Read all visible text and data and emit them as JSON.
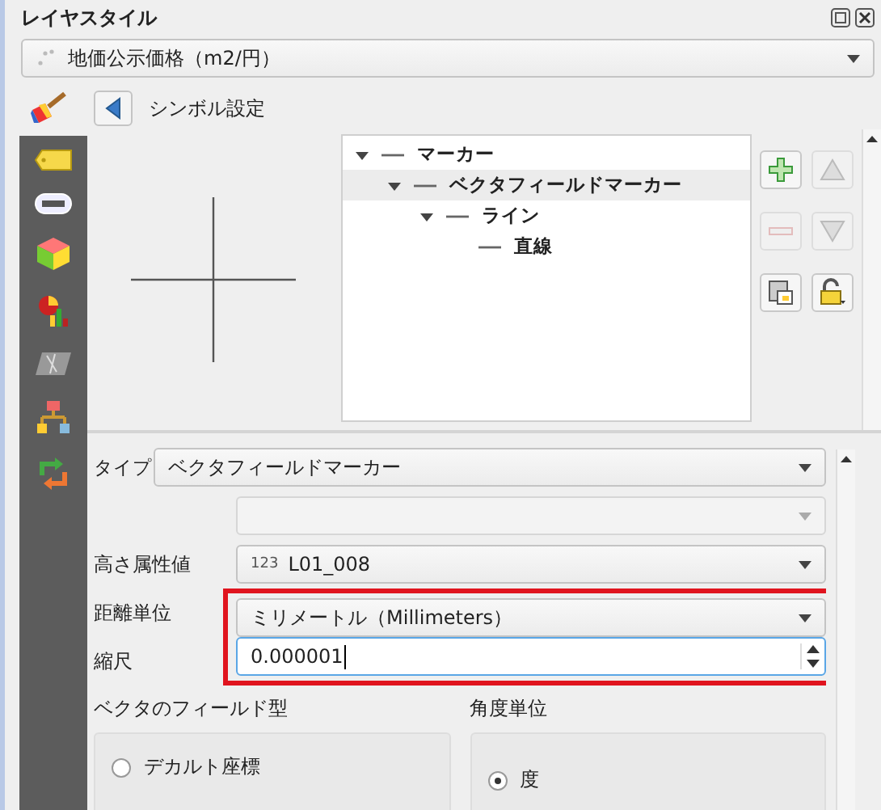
{
  "window": {
    "title": "レイヤスタイル"
  },
  "layer_combo": {
    "value": "地価公示価格（m2/円）"
  },
  "symbol_header": {
    "title": "シンボル設定"
  },
  "symbol_tree": [
    {
      "label": "マーカー",
      "selected": false,
      "expanded": true,
      "children": [
        {
          "label": "ベクタフィールドマーカー",
          "selected": true,
          "expanded": true,
          "children": [
            {
              "label": "ライン",
              "selected": false,
              "expanded": true,
              "children": [
                {
                  "label": "直線",
                  "selected": false
                }
              ]
            }
          ]
        }
      ]
    }
  ],
  "layer_buttons": [
    {
      "kind": "add",
      "disabled": false
    },
    {
      "kind": "up",
      "disabled": true
    },
    {
      "kind": "remove",
      "disabled": true
    },
    {
      "kind": "down",
      "disabled": true
    },
    {
      "kind": "duplicate",
      "disabled": false
    },
    {
      "kind": "lock",
      "disabled": false
    }
  ],
  "type_row": {
    "label": "タイプ",
    "value": "ベクタフィールドマーカー"
  },
  "form_rows": [
    {
      "kind": "combo",
      "disabled": true,
      "highlighted": false
    },
    {
      "kind": "combo",
      "label": "高さ属性値",
      "badge": "123",
      "value": "L01_008",
      "disabled": false,
      "highlighted": false
    },
    {
      "kind": "combo",
      "label": "距離単位",
      "value": "ミリメートル（Millimeters）",
      "disabled": false,
      "highlighted": true
    },
    {
      "kind": "spin",
      "label": "縮尺",
      "value": "0.000001",
      "disabled": false,
      "highlighted": true
    }
  ],
  "groups": [
    {
      "title": "ベクタのフィールド型",
      "options": [
        {
          "label": "デカルト座標",
          "selected": false
        }
      ]
    },
    {
      "title": "角度単位",
      "options": [
        {
          "label": "度",
          "selected": true
        }
      ]
    }
  ]
}
